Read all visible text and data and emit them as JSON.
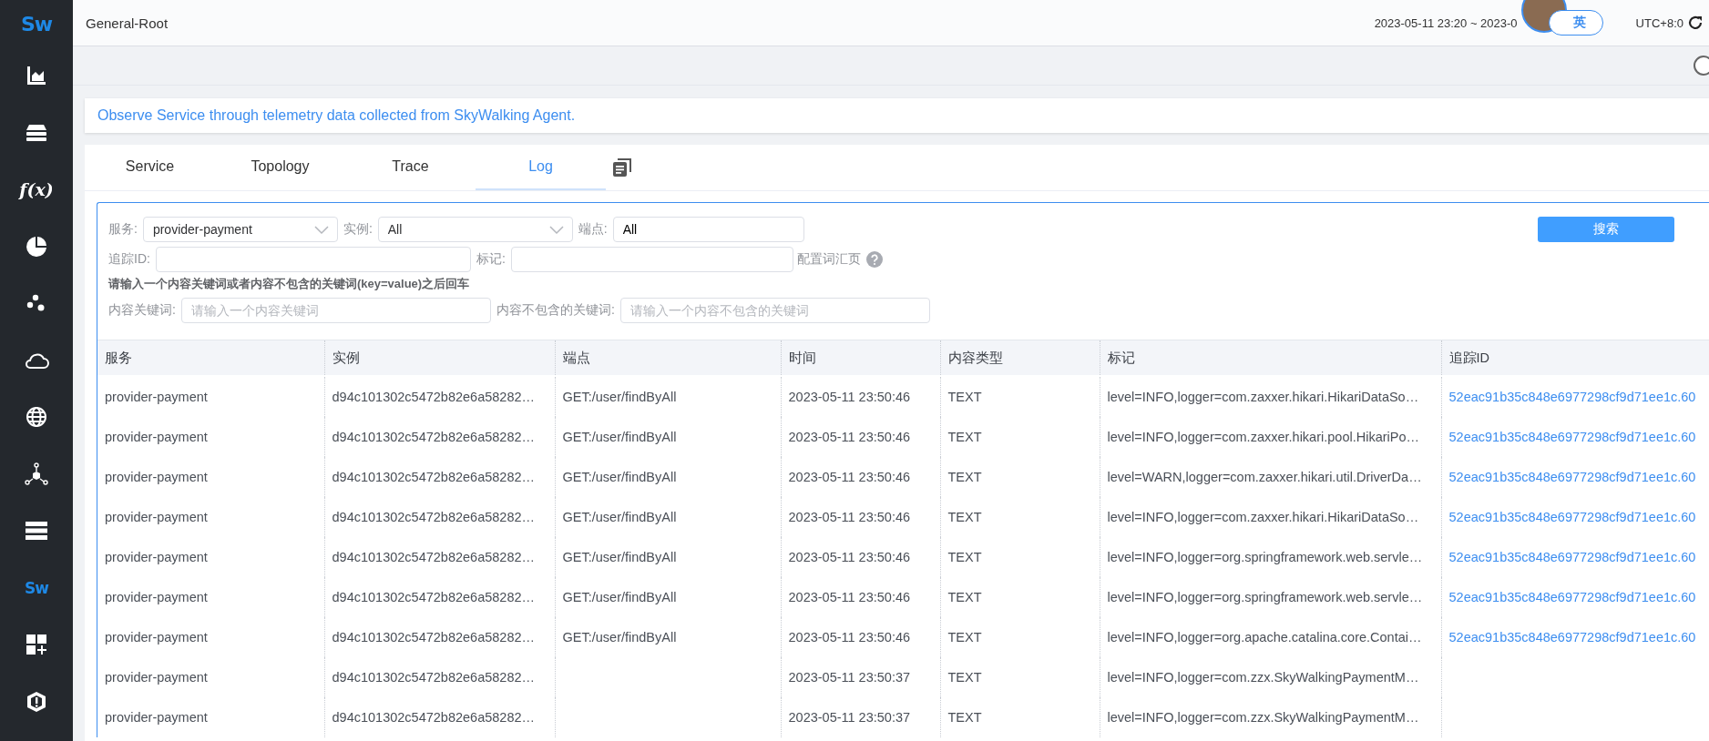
{
  "sidebar": {
    "logo": "Sw",
    "items": [
      {
        "kind": "chart"
      },
      {
        "kind": "layers"
      },
      {
        "kind": "function",
        "label": "f(x)"
      },
      {
        "kind": "pie"
      },
      {
        "kind": "dots"
      },
      {
        "kind": "cloud"
      },
      {
        "kind": "globe"
      },
      {
        "kind": "nodes"
      },
      {
        "kind": "servers"
      },
      {
        "kind": "logo",
        "label": "Sw"
      },
      {
        "kind": "dashboard"
      },
      {
        "kind": "shield"
      }
    ]
  },
  "header": {
    "title": "General-Root",
    "time_range": "2023-05-11 23:20 ~ 2023-0",
    "language": "英",
    "timezone": "UTC+8:0"
  },
  "banner": "Observe Service through telemetry data collected from SkyWalking Agent.",
  "tabs": [
    {
      "label": "Service",
      "selected": false
    },
    {
      "label": "Topology",
      "selected": false
    },
    {
      "label": "Trace",
      "selected": false
    },
    {
      "label": "Log",
      "selected": true
    }
  ],
  "filters": {
    "service": {
      "label": "服务:",
      "value": "provider-payment"
    },
    "instance": {
      "label": "实例:",
      "value": "All"
    },
    "endpoint": {
      "label": "端点:",
      "value": "All"
    },
    "trace_id": {
      "label": "追踪ID:"
    },
    "tags": {
      "label": "标记:"
    },
    "vocabulary_link": "配置词汇页",
    "hint": "请输入一个内容关键词或者内容不包含的关键词(key=value)之后回车",
    "keywords": {
      "label": "内容关键词:",
      "placeholder": "请输入一个内容关键词"
    },
    "exclude_keywords": {
      "label": "内容不包含的关键词:",
      "placeholder": "请输入一个内容不包含的关键词"
    },
    "search_button": "搜索"
  },
  "table": {
    "columns": [
      "服务",
      "实例",
      "端点",
      "时间",
      "内容类型",
      "标记",
      "追踪ID"
    ],
    "rows": [
      {
        "service": "provider-payment",
        "instance": "d94c101302c5472b82e6a58282…",
        "endpoint": "GET:/user/findByAll",
        "time": "2023-05-11 23:50:46",
        "content_type": "TEXT",
        "tags": "level=INFO,logger=com.zaxxer.hikari.HikariDataSo…",
        "trace_id": "52eac91b35c848e6977298cf9d71ee1c.60"
      },
      {
        "service": "provider-payment",
        "instance": "d94c101302c5472b82e6a58282…",
        "endpoint": "GET:/user/findByAll",
        "time": "2023-05-11 23:50:46",
        "content_type": "TEXT",
        "tags": "level=INFO,logger=com.zaxxer.hikari.pool.HikariPo…",
        "trace_id": "52eac91b35c848e6977298cf9d71ee1c.60"
      },
      {
        "service": "provider-payment",
        "instance": "d94c101302c5472b82e6a58282…",
        "endpoint": "GET:/user/findByAll",
        "time": "2023-05-11 23:50:46",
        "content_type": "TEXT",
        "tags": "level=WARN,logger=com.zaxxer.hikari.util.DriverDa…",
        "trace_id": "52eac91b35c848e6977298cf9d71ee1c.60"
      },
      {
        "service": "provider-payment",
        "instance": "d94c101302c5472b82e6a58282…",
        "endpoint": "GET:/user/findByAll",
        "time": "2023-05-11 23:50:46",
        "content_type": "TEXT",
        "tags": "level=INFO,logger=com.zaxxer.hikari.HikariDataSo…",
        "trace_id": "52eac91b35c848e6977298cf9d71ee1c.60"
      },
      {
        "service": "provider-payment",
        "instance": "d94c101302c5472b82e6a58282…",
        "endpoint": "GET:/user/findByAll",
        "time": "2023-05-11 23:50:46",
        "content_type": "TEXT",
        "tags": "level=INFO,logger=org.springframework.web.servle…",
        "trace_id": "52eac91b35c848e6977298cf9d71ee1c.60"
      },
      {
        "service": "provider-payment",
        "instance": "d94c101302c5472b82e6a58282…",
        "endpoint": "GET:/user/findByAll",
        "time": "2023-05-11 23:50:46",
        "content_type": "TEXT",
        "tags": "level=INFO,logger=org.springframework.web.servle…",
        "trace_id": "52eac91b35c848e6977298cf9d71ee1c.60"
      },
      {
        "service": "provider-payment",
        "instance": "d94c101302c5472b82e6a58282…",
        "endpoint": "GET:/user/findByAll",
        "time": "2023-05-11 23:50:46",
        "content_type": "TEXT",
        "tags": "level=INFO,logger=org.apache.catalina.core.Contai…",
        "trace_id": "52eac91b35c848e6977298cf9d71ee1c.60"
      },
      {
        "service": "provider-payment",
        "instance": "d94c101302c5472b82e6a58282…",
        "time": "2023-05-11 23:50:37",
        "content_type": "TEXT",
        "tags": "level=INFO,logger=com.zzx.SkyWalkingPaymentM…"
      },
      {
        "service": "provider-payment",
        "instance": "d94c101302c5472b82e6a58282…",
        "time": "2023-05-11 23:50:37",
        "content_type": "TEXT",
        "tags": "level=INFO,logger=com.zzx.SkyWalkingPaymentM…"
      }
    ]
  }
}
